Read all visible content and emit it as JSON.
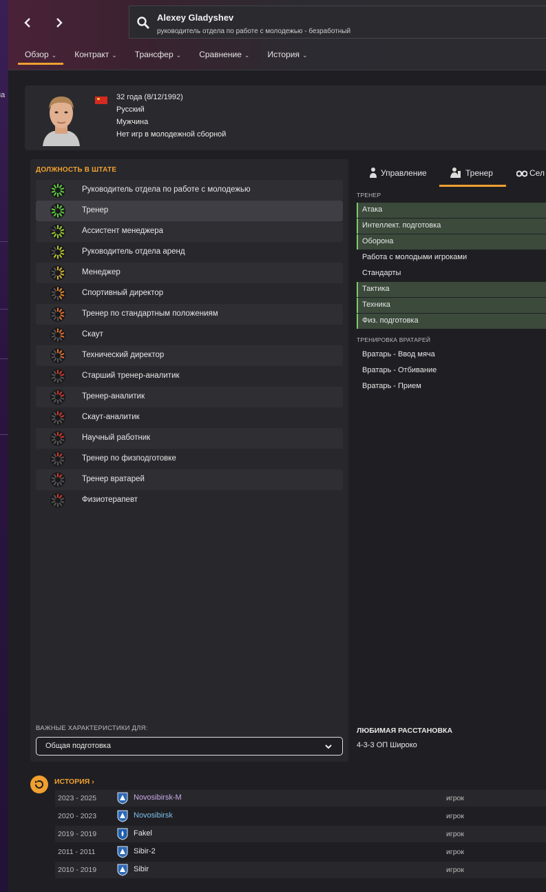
{
  "header": {
    "back_icon": "chevron-left-icon",
    "forward_icon": "chevron-right-icon",
    "search_icon": "search-icon",
    "person_name": "Alexey Gladyshev",
    "person_role": "руководитель отдела по работе с молодежью - безработный",
    "tabs": [
      {
        "label": "Обзор",
        "active": true
      },
      {
        "label": "Контракт",
        "active": false
      },
      {
        "label": "Трансфер",
        "active": false
      },
      {
        "label": "Сравнение",
        "active": false
      },
      {
        "label": "История",
        "active": false
      }
    ],
    "accent_color": "#f0a030"
  },
  "left_strip_text": "иа",
  "profile": {
    "age": "32 года (8/12/1992)",
    "nationality": "Русский",
    "gender": "Мужчина",
    "youth_caps": "Нет игр в молодежной сборной"
  },
  "staff_roles": {
    "title": "ДОЛЖНОСТЬ В ШТАТЕ",
    "items": [
      {
        "label": "Руководитель отдела по работе с молодежью",
        "dial_color": "#5fd03a",
        "level": 1.0
      },
      {
        "label": "Тренер",
        "dial_color": "#5fd03a",
        "level": 0.9
      },
      {
        "label": "Ассистент менеджера",
        "dial_color": "#9ccf2e",
        "level": 0.75
      },
      {
        "label": "Руководитель отдела аренд",
        "dial_color": "#b9c82b",
        "level": 0.7
      },
      {
        "label": "Менеджер",
        "dial_color": "#d7b52a",
        "level": 0.6
      },
      {
        "label": "Спортивный директор",
        "dial_color": "#e38a2a",
        "level": 0.5
      },
      {
        "label": "Тренер по стандартным положениям",
        "dial_color": "#e8702a",
        "level": 0.45
      },
      {
        "label": "Скаут",
        "dial_color": "#e8702a",
        "level": 0.4
      },
      {
        "label": "Технический директор",
        "dial_color": "#e8702a",
        "level": 0.4
      },
      {
        "label": "Старший тренер-аналитик",
        "dial_color": "#d9362a",
        "level": 0.3
      },
      {
        "label": "Тренер-аналитик",
        "dial_color": "#d9362a",
        "level": 0.3
      },
      {
        "label": "Скаут-аналитик",
        "dial_color": "#d9362a",
        "level": 0.25
      },
      {
        "label": "Научный работник",
        "dial_color": "#d9362a",
        "level": 0.25
      },
      {
        "label": "Тренер по физподготовке",
        "dial_color": "#d9362a",
        "level": 0.2
      },
      {
        "label": "Тренер вратарей",
        "dial_color": "#d9362a",
        "level": 0.2
      },
      {
        "label": "Физиотерапевт",
        "dial_color": "#d9362a",
        "level": 0.15
      }
    ],
    "selected_index": 1,
    "key_attrs_label": "ВАЖНЫЕ ХАРАКТЕРИСТИКИ ДЛЯ:",
    "key_attrs_value": "Общая подготовка",
    "key_attrs_icon": "chevron-down-icon"
  },
  "attributes_panel": {
    "tabs": [
      {
        "label": "Управление",
        "icon": "management-icon",
        "active": false
      },
      {
        "label": "Тренер",
        "icon": "coach-icon",
        "active": true
      },
      {
        "label": "Сел",
        "icon": "binoculars-icon",
        "active": false
      }
    ],
    "coach_label": "ТРЕНЕР",
    "coach_attrs": [
      {
        "label": "Атака",
        "highlighted": true
      },
      {
        "label": "Интеллект. подготовка",
        "highlighted": true
      },
      {
        "label": "Оборона",
        "highlighted": true
      },
      {
        "label": "Работа с молодыми игроками",
        "highlighted": false
      },
      {
        "label": "Стандарты",
        "highlighted": false
      },
      {
        "label": "Тактика",
        "highlighted": true
      },
      {
        "label": "Техника",
        "highlighted": true
      },
      {
        "label": "Физ. подготовка",
        "highlighted": true
      }
    ],
    "gk_label": "ТРЕНИРОВКА ВРАТАРЕЙ",
    "gk_attrs": [
      {
        "label": "Вратарь - Ввод мяча"
      },
      {
        "label": "Вратарь - Отбивание"
      },
      {
        "label": "Вратарь - Прием"
      }
    ],
    "favourite_formation_title": "ЛЮБИМАЯ РАССТАНОВКА",
    "favourite_formation": "4-3-3 ОП Широко"
  },
  "history": {
    "title": "ИСТОРИЯ",
    "icon": "history-icon",
    "rows": [
      {
        "years": "2023 - 2025",
        "club": "Novosibirsk-M",
        "club_style": "violet",
        "crest": "novosibirsk-crest-icon",
        "position": "игрок"
      },
      {
        "years": "2020 - 2023",
        "club": "Novosibirsk",
        "club_style": "blue",
        "crest": "novosibirsk-crest-icon",
        "position": "игрок"
      },
      {
        "years": "2019 - 2019",
        "club": "Fakel",
        "club_style": "plain",
        "crest": "fakel-crest-icon",
        "position": "игрок"
      },
      {
        "years": "2011 - 2011",
        "club": "Sibir-2",
        "club_style": "plain",
        "crest": "sibir-crest-icon",
        "position": "игрок"
      },
      {
        "years": "2010 - 2019",
        "club": "Sibir",
        "club_style": "plain",
        "crest": "sibir-crest-icon",
        "position": "игрок"
      }
    ]
  }
}
